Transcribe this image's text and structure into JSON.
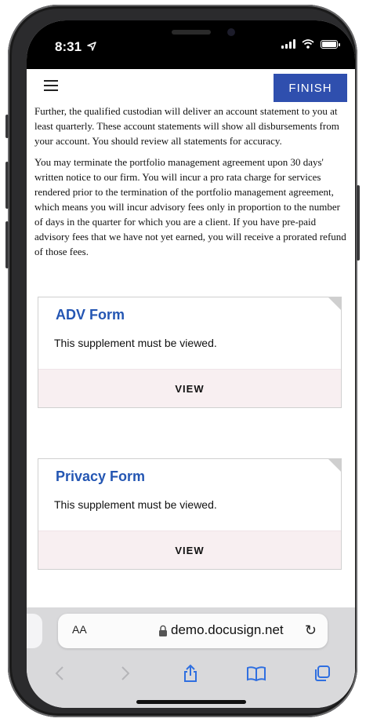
{
  "status": {
    "time": "8:31"
  },
  "toolbar": {
    "finish_label": "FINISH"
  },
  "document": {
    "paragraphs": [
      "Further, the qualified custodian will deliver an account statement to you at least quarterly. These account statements will show all disbursements from your account. You should review all statements for accuracy.",
      "You may terminate the portfolio management agreement upon 30 days' written notice to our firm. You will incur a pro rata charge for services rendered prior to the termination of the portfolio management agreement, which means you will incur advisory fees only in proportion to the number of days in the quarter for which you are a client. If you have pre-paid advisory fees that we have not yet earned, you will receive a prorated refund of those fees."
    ]
  },
  "supplements": [
    {
      "title": "ADV Form",
      "description": "This supplement must be viewed.",
      "view_label": "VIEW"
    },
    {
      "title": "Privacy Form",
      "description": "This supplement must be viewed.",
      "view_label": "VIEW"
    }
  ],
  "browser": {
    "aa_label": "AA",
    "url": "demo.docusign.net"
  },
  "colors": {
    "accent": "#2f4fae",
    "link": "#2456b3",
    "safari_active": "#2f6fe0"
  },
  "icons": [
    "location-arrow-icon",
    "signal-icon",
    "wifi-icon",
    "battery-icon",
    "menu-icon",
    "lock-icon",
    "reload-icon",
    "back-icon",
    "forward-icon",
    "share-icon",
    "bookmarks-icon",
    "tabs-icon"
  ]
}
